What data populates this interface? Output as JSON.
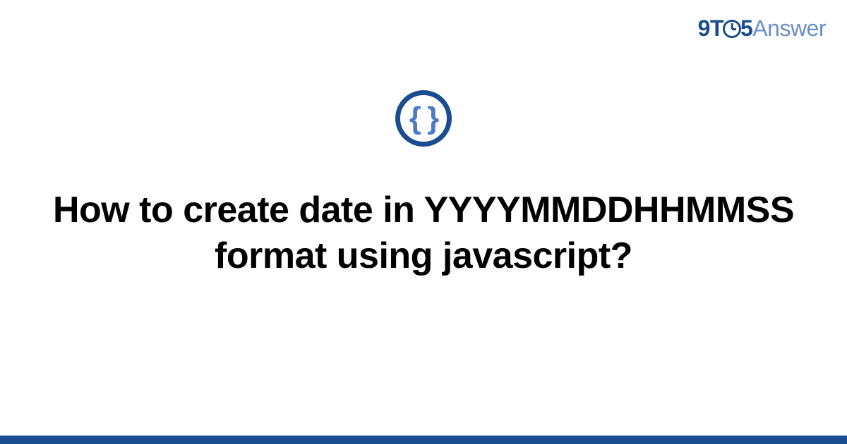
{
  "logo": {
    "part1": "9T",
    "part2": "5",
    "part3": "Answer"
  },
  "icon": {
    "braces": "{ }"
  },
  "title": "How to create date in YYYYMMDDHHMMSS format using javascript?"
}
